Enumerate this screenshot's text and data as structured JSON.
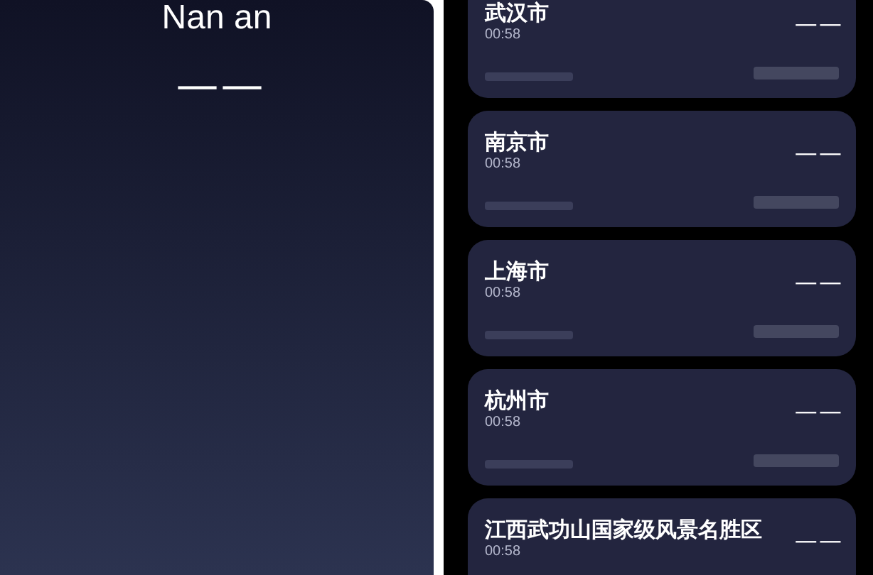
{
  "detail": {
    "city": "Nan an",
    "temperature": "— —"
  },
  "cities": [
    {
      "name": "武汉市",
      "time": "00:58",
      "temperature": "— —"
    },
    {
      "name": "南京市",
      "time": "00:58",
      "temperature": "— —"
    },
    {
      "name": "上海市",
      "time": "00:58",
      "temperature": "— —"
    },
    {
      "name": "杭州市",
      "time": "00:58",
      "temperature": "— —"
    },
    {
      "name": "江西武功山国家级风景名胜区",
      "time": "00:58",
      "temperature": "— —"
    }
  ]
}
